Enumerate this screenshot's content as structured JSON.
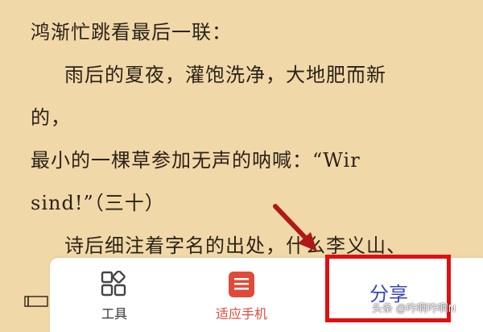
{
  "reader": {
    "lines": [
      "鸿渐忙跳看最后一联：",
      "雨后的夏夜，灌饱洗净，大地肥而新",
      "的，",
      "最小的一棵草参加无声的呐喊：“Wir",
      "sind!”（三十）",
      "诗后细注着字名的出处，什么李义山、"
    ]
  },
  "toolbar": {
    "tools_label": "工具",
    "tools_icon": "grid-icon",
    "fit_label": "适应手机",
    "fit_icon": "list-icon",
    "share_label": "分享"
  },
  "watermark": "头条 @咋啊咋啊N",
  "colors": {
    "page_background": "#f1d8a8",
    "text": "#2a2218",
    "accent_red": "#e04a3a",
    "highlight_box": "#e01010",
    "share_text": "#3a46b8"
  }
}
